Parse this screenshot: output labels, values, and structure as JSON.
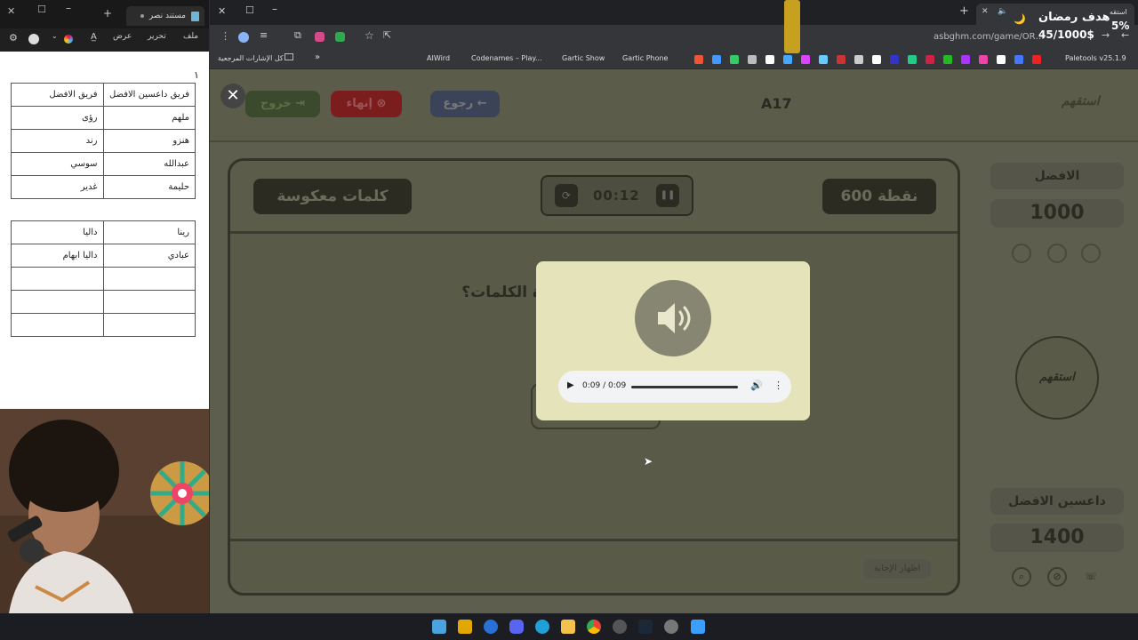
{
  "notepad": {
    "tab_title": "مستند نصر",
    "menu": {
      "file": "ملف",
      "edit": "تحرير",
      "view": "عرض"
    },
    "line_one": "١",
    "table1": [
      [
        "فريق داعسين الافضل",
        "فريق الافضل"
      ],
      [
        "ملهم",
        "رؤى"
      ],
      [
        "هنزو",
        "رند"
      ],
      [
        "عبدالله",
        "سوسي"
      ],
      [
        "حليمة",
        "غدير"
      ]
    ],
    "table2": [
      [
        "رينا",
        "داليا"
      ],
      [
        "عبادي",
        "داليا ابهام"
      ],
      [
        "",
        ""
      ],
      [
        "",
        ""
      ],
      [
        "",
        ""
      ]
    ]
  },
  "stream_overlay": {
    "goal_title": "هدف رمضان",
    "goal_progress": "45/1000$",
    "percent": "5%",
    "percent_value": 0.05
  },
  "browser": {
    "tab_label": "استقه",
    "url": "asbghm.com/game/OREBLOC",
    "bookmarks_label": "كل الإشارات المرجعية",
    "bookmarks": [
      "AIWird",
      "Codenames – Play...",
      "Gartic Show",
      "Gartic Phone",
      "Paletools v25.1.9"
    ]
  },
  "game": {
    "logo": "استقهم",
    "room_code": "A17",
    "back_label": "رجوع",
    "end_label": "إنهاء",
    "exit_label": "خروج",
    "points_label": "600 نقطة",
    "timer": "00:12",
    "category": "كلمات معكوسة",
    "question_partial": "ة   الكلمات؟",
    "show_answer": "اظهار الإجابة",
    "team_top": {
      "name": "الافضل",
      "score": "1000"
    },
    "team_bottom": {
      "name": "داعسين الافضل",
      "score": "1400"
    },
    "center_logo": "استقهم"
  },
  "modal": {
    "audio_time": "0:09 / 0:09",
    "audio_progress": 1.0
  },
  "colors": {
    "modal_bg": "#e4e3b9",
    "speaker_circle": "#868672",
    "pill_dark": "#2b2b22",
    "end_red": "#7c1d1d",
    "back_blue": "#3b4358",
    "exit_green": "#3b4a2c"
  }
}
